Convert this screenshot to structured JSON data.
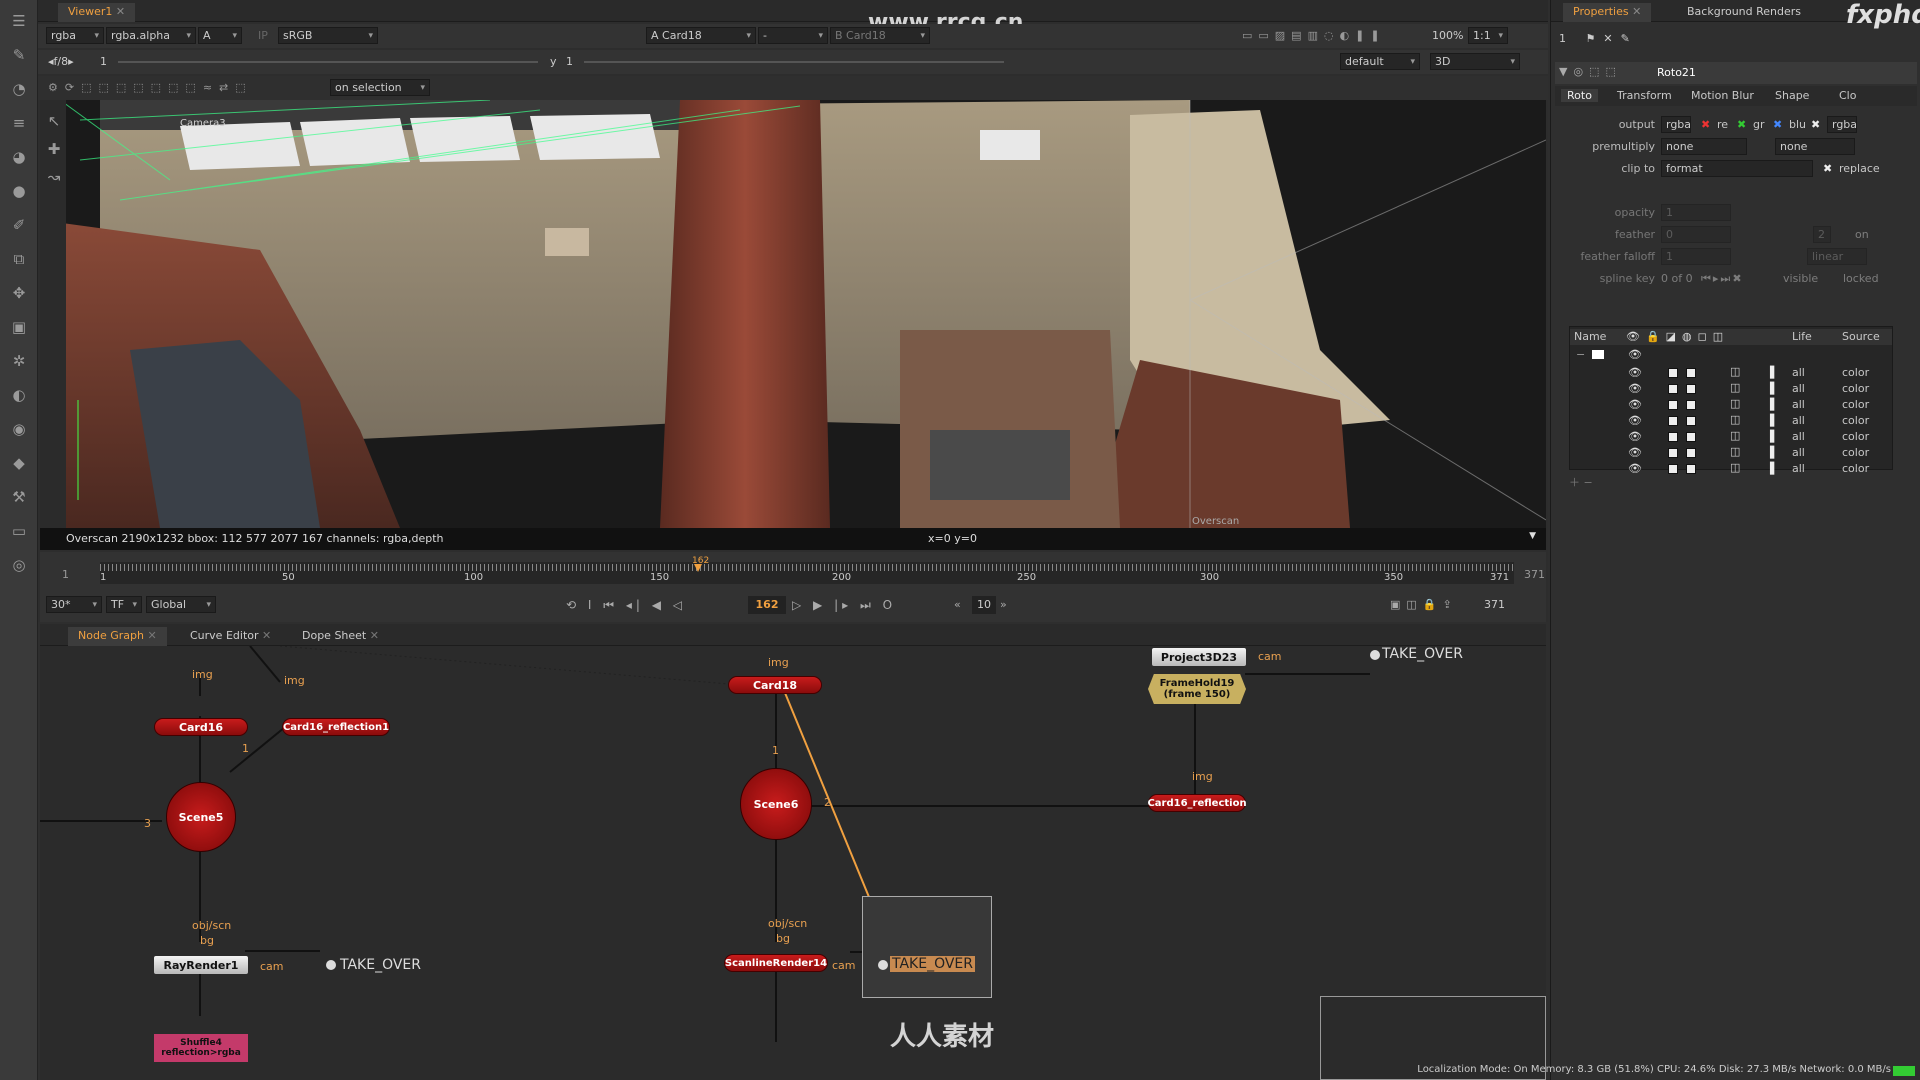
{
  "viewer": {
    "tab": "Viewer1",
    "channels": "rgba",
    "alpha": "rgba.alpha",
    "a_select": "A",
    "ip_label": "IP",
    "colorspace": "sRGB",
    "input_a": "A  Card18",
    "dash": "-",
    "input_b": "B  Card18",
    "zoom": "100%",
    "ratio": "1:1",
    "fstop": "f/8",
    "gain": "1",
    "y_label": "y",
    "gamma": "1",
    "lut": "default",
    "mode3d": "3D",
    "selection": "on selection",
    "camera_label": "Camera3",
    "overscan_label": "Overscan",
    "watermark": "www.rrcg.cn"
  },
  "info_bar": {
    "text": "Overscan 2190x1232  bbox: 112 577 2077 167 channels: rgba,depth",
    "coords": "x=0 y=0"
  },
  "timeline": {
    "start": "1",
    "end": "371",
    "ticks": [
      "1",
      "50",
      "100",
      "150",
      "200",
      "250",
      "300",
      "350",
      "371"
    ],
    "current": "162",
    "fps": "30*",
    "tf": "TF",
    "scope": "Global",
    "step": "10",
    "end_frame": "371",
    "in_label": "I",
    "out_label": "O"
  },
  "panel_tabs": [
    "Node Graph",
    "Curve Editor",
    "Dope Sheet"
  ],
  "nodes": {
    "card16": "Card16",
    "card16_refl1": "Card16_reflection1",
    "scene5": "Scene5",
    "rayrender": "RayRender1",
    "shuffle": "Shuffle4\nreflection>rgba",
    "card18": "Card18",
    "scene6": "Scene6",
    "scanline": "ScanlineRender14",
    "project3d": "Project3D23",
    "framehold": "FrameHold19\n(frame 150)",
    "card16_refl": "Card16_reflection",
    "take_over_1": "TAKE_OVER",
    "take_over_2": "TAKE_OVER",
    "take_over_3": "TAKE_OVER"
  },
  "edge_labels": {
    "img": "img",
    "cam": "cam",
    "obj_scn": "obj/scn",
    "bg": "bg",
    "n1": "1",
    "n2": "2",
    "n3": "3"
  },
  "properties": {
    "tabs": [
      "Properties",
      "Background Renders"
    ],
    "node_name": "Roto21",
    "inner_tabs": [
      "Roto",
      "Transform",
      "Motion Blur",
      "Shape",
      "Clo"
    ],
    "output_label": "output",
    "output_value": "rgba",
    "ch_red": "re",
    "ch_green": "gr",
    "ch_blue": "blu",
    "ch_alpha": "rgba",
    "premultiply_label": "premultiply",
    "premultiply_value": "none",
    "premultiply_value2": "none",
    "clip_label": "clip to",
    "clip_value": "format",
    "replace_label": "replace",
    "opacity_label": "opacity",
    "opacity_value": "1",
    "feather_label": "feather",
    "feather_value": "0",
    "feather_right": "2",
    "feather_on": "on",
    "falloff_label": "feather falloff",
    "falloff_value": "1",
    "falloff_mode": "linear",
    "spline_label": "spline key",
    "spline_value": "0 of 0",
    "visible_label": "visible",
    "locked_label": "locked",
    "columns": [
      "Name",
      "Life",
      "Source"
    ],
    "rows": [
      {
        "life": "all",
        "source": "color"
      },
      {
        "life": "all",
        "source": "color"
      },
      {
        "life": "all",
        "source": "color"
      },
      {
        "life": "all",
        "source": "color"
      },
      {
        "life": "all",
        "source": "color"
      },
      {
        "life": "all",
        "source": "color"
      },
      {
        "life": "all",
        "source": "color"
      }
    ]
  },
  "status_bar": "Localization Mode: On  Memory: 8.3 GB (51.8%)  CPU: 24.6%  Disk: 27.3 MB/s  Network: 0.0 MB/s",
  "watermark_logo": "fxphd",
  "watermark_text": "人人素材",
  "colors": {
    "accent": "#f0a040",
    "node_red": "#b81818",
    "node_tan": "#c8b060",
    "node_pink": "#c43a6a"
  }
}
